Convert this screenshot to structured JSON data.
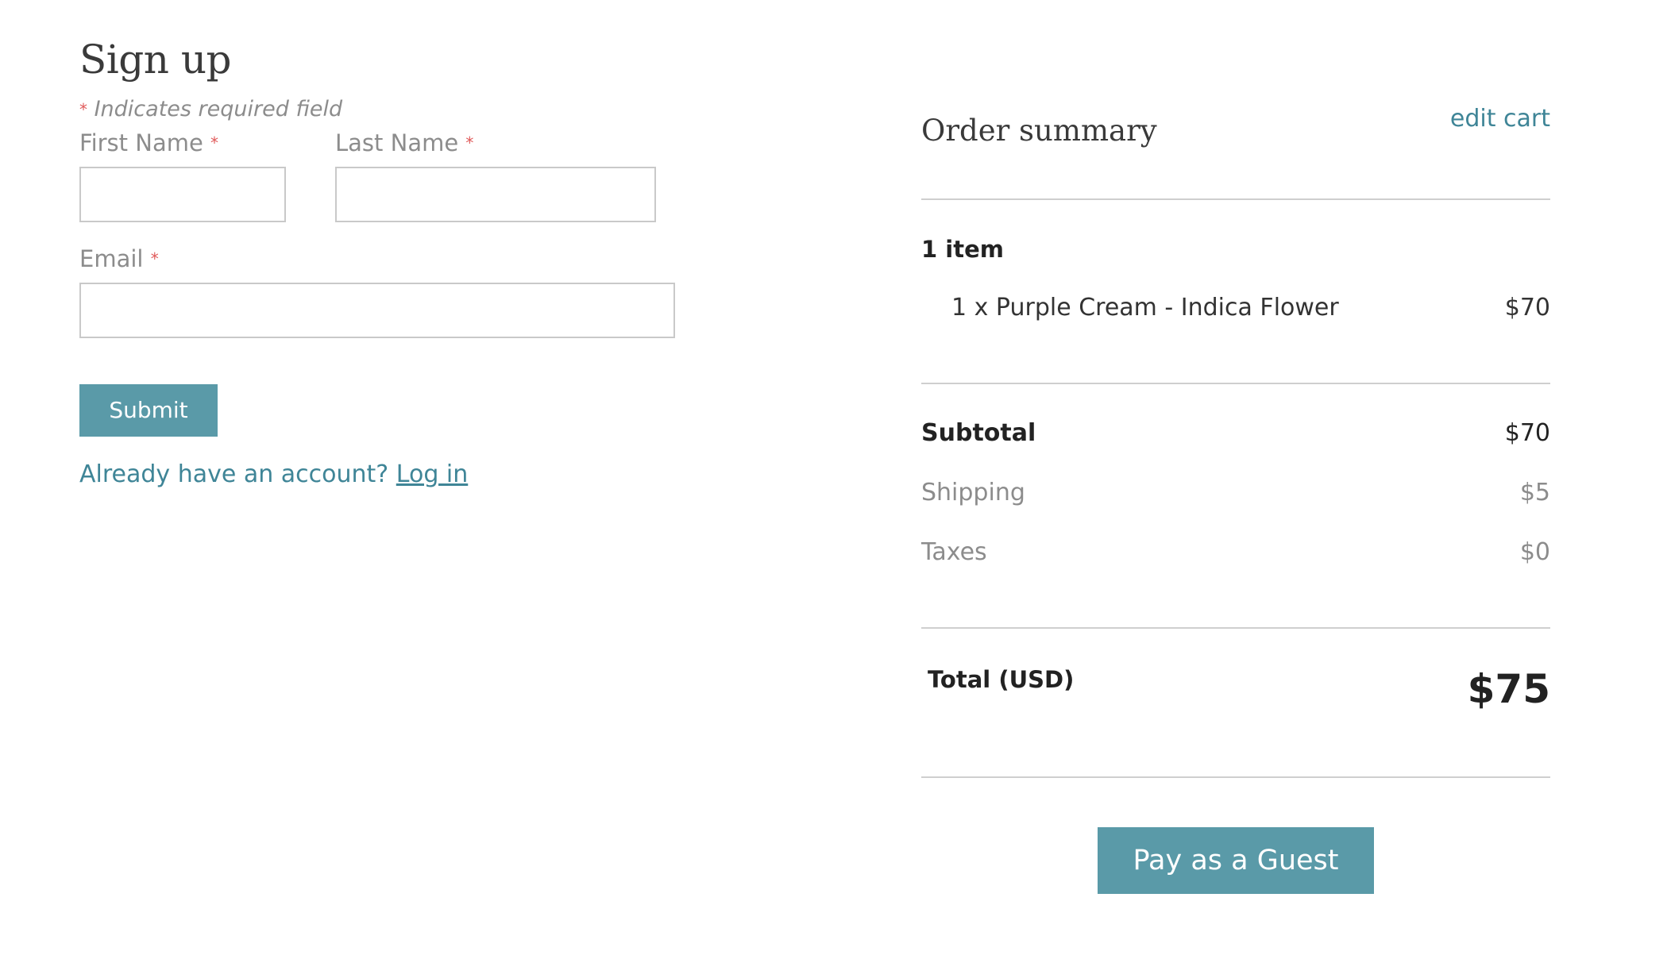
{
  "signup": {
    "title": "Sign up",
    "required_marker": "*",
    "required_note": "Indicates required field",
    "first_name_label": "First Name",
    "last_name_label": "Last Name",
    "email_label": "Email",
    "first_name_value": "",
    "last_name_value": "",
    "email_value": "",
    "submit_label": "Submit",
    "account_prompt": "Already have an account?",
    "login_label": "Log in"
  },
  "summary": {
    "title": "Order summary",
    "edit_cart_label": "edit cart",
    "item_count": "1 item",
    "items": [
      {
        "description": "1 x Purple Cream - Indica Flower",
        "price": "$70"
      }
    ],
    "subtotal_label": "Subtotal",
    "subtotal_value": "$70",
    "shipping_label": "Shipping",
    "shipping_value": "$5",
    "taxes_label": "Taxes",
    "taxes_value": "$0",
    "total_label": "Total (USD)",
    "total_value": "$75",
    "guest_button_label": "Pay as a Guest"
  },
  "colors": {
    "accent": "#5a9aa8",
    "link": "#3f8597",
    "required": "#e05a5a",
    "muted_text": "#8c8c8c"
  }
}
